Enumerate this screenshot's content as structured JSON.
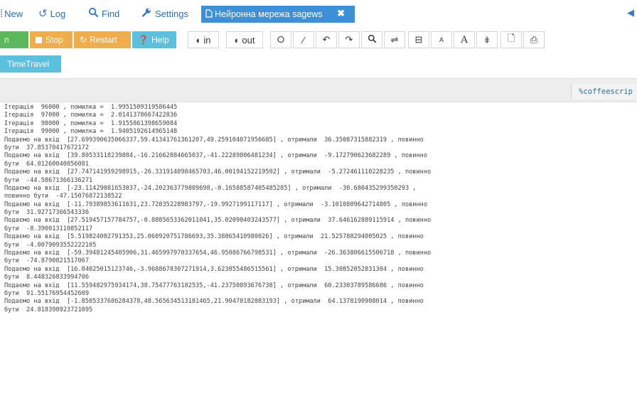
{
  "menu": {
    "new_label": "New",
    "log_label": "Log",
    "find_label": "Find",
    "settings_label": "Settings",
    "tab_title": "Нейронна мережа sagews",
    "tab_close": "✖"
  },
  "toolbar": {
    "run_label": "n",
    "stop_label": "Stop",
    "restart_label": "Restart",
    "help_label": "Help",
    "in_label": "in",
    "out_label": "out",
    "timetravel_label": "TimeTravel"
  },
  "mode_label": "%coffeescrip",
  "output_lines": [
    "Ітерація  96000 , помилка =  1.9951509319586445",
    "Ітерація  97000 , помилка =  2.0141378667422836",
    "Ітерація  98000 , помилка =  1.9155861398659084",
    "Ітерація  99000 , помилка =  1.9405192614965148",
    "Подаємо на вхід  [27.699390635066337,59.41341761361207,49.259104071956685] , отримали  36.35087315882319 , повинно",
    "бути  37.85370417672172",
    "Подаємо на вхід  [39.80533118239884,-16.21662884665037,-41.22289806481234] , отримали  -9.172790623682289 , повинно",
    "бути  64.01260040056081",
    "Подаємо на вхід  [27.747141959298915,-26.331914098465703,46.00194152219592] , отримали  -5.272461110228235 , повинно",
    "бути  -44.58671366136271",
    "Подаємо на вхід  [-23.11429081653037,-24.202363779809698,-0.16588587405485285] , отримали  -30.680435299350293 ,",
    "повинно бути  -47.15076872138522",
    "Подаємо на вхід  [-11.79389853611631,23.72835228983797,-19.9927199117117] , отримали  -3.1010809642714805 , повинно",
    "бути  31.92717366543336",
    "Подаємо на вхід  [27.519457157784757,-0.8885653362011041,35.02090403243577] , отримали  37.646162889115914 , повинно",
    "бути  -8.390013110852117",
    "Подаємо на вхід  [5.519824002791353,25.060920751786693,35.38865410980026] , отримали  21.525788294005025 , повинно",
    "бути  -4.0079093552222105",
    "Подаємо на вхід  [-59.39481245405906,31.465997970337654,46.95086766798531] , отримали  -26.363806615506718 , повинно",
    "бути  -74.8790821517067",
    "Подаємо на вхід  [16.04025015123746,-3.9688678307271914,3.623055486515561] , отримали  15.30852052831304 , повинно",
    "бути  8.448326833994706",
    "Подаємо на вхід  [11.559482975934174,38.75477763182535,-41.23750893676738] , отримали  60.23303789586686 , повинно",
    "бути  91.55176954452609",
    "Подаємо на вхід  [-1.8505337686284378,48.565634513181465,21.90470182083193] , отримали  64.1378190908014 , повинно",
    "бути  24.818398923721095"
  ]
}
